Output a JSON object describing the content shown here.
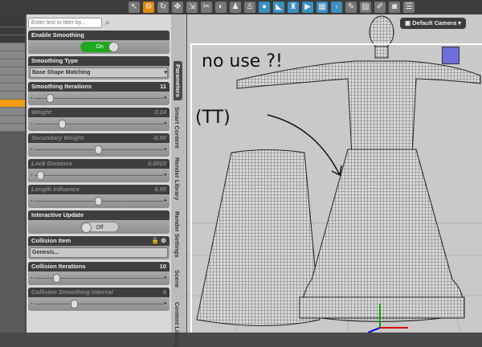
{
  "filter": {
    "placeholder": "Enter text to filter by..."
  },
  "properties": [
    {
      "label": "Enable Smoothing",
      "type": "toggle",
      "value": "On"
    },
    {
      "label": "Smoothing Type",
      "type": "dropdown",
      "value": "Base Shape Matching"
    },
    {
      "label": "Smoothing Iterations",
      "value": "11",
      "position": 0.1
    },
    {
      "label": "Weight",
      "value": "0.14",
      "position": 0.2,
      "dim": true
    },
    {
      "label": "Secondary Weight",
      "value": "-0.50",
      "position": 0.5,
      "dim": true
    },
    {
      "label": "Lock Distance",
      "value": "0.0010",
      "position": 0.02,
      "dim": true
    },
    {
      "label": "Length Influence",
      "value": "0.50",
      "position": 0.5,
      "dim": true
    },
    {
      "label": "Interactive Update",
      "type": "toggle",
      "value": "Off"
    },
    {
      "label": "Collision Item",
      "type": "item",
      "value": "Genesis..."
    },
    {
      "label": "Collision Iterations",
      "value": "10",
      "position": 0.15
    },
    {
      "label": "Collision Smoothing Interval",
      "value": "6",
      "position": 0.3,
      "dim": true
    }
  ],
  "tabs": [
    "Parameters",
    "Smart Content",
    "Render Library",
    "Render Settings",
    "Scene",
    "Content Library"
  ],
  "viewport": {
    "camera": "Default Camera",
    "annotations": [
      "no use ?!",
      "(TT)"
    ]
  }
}
